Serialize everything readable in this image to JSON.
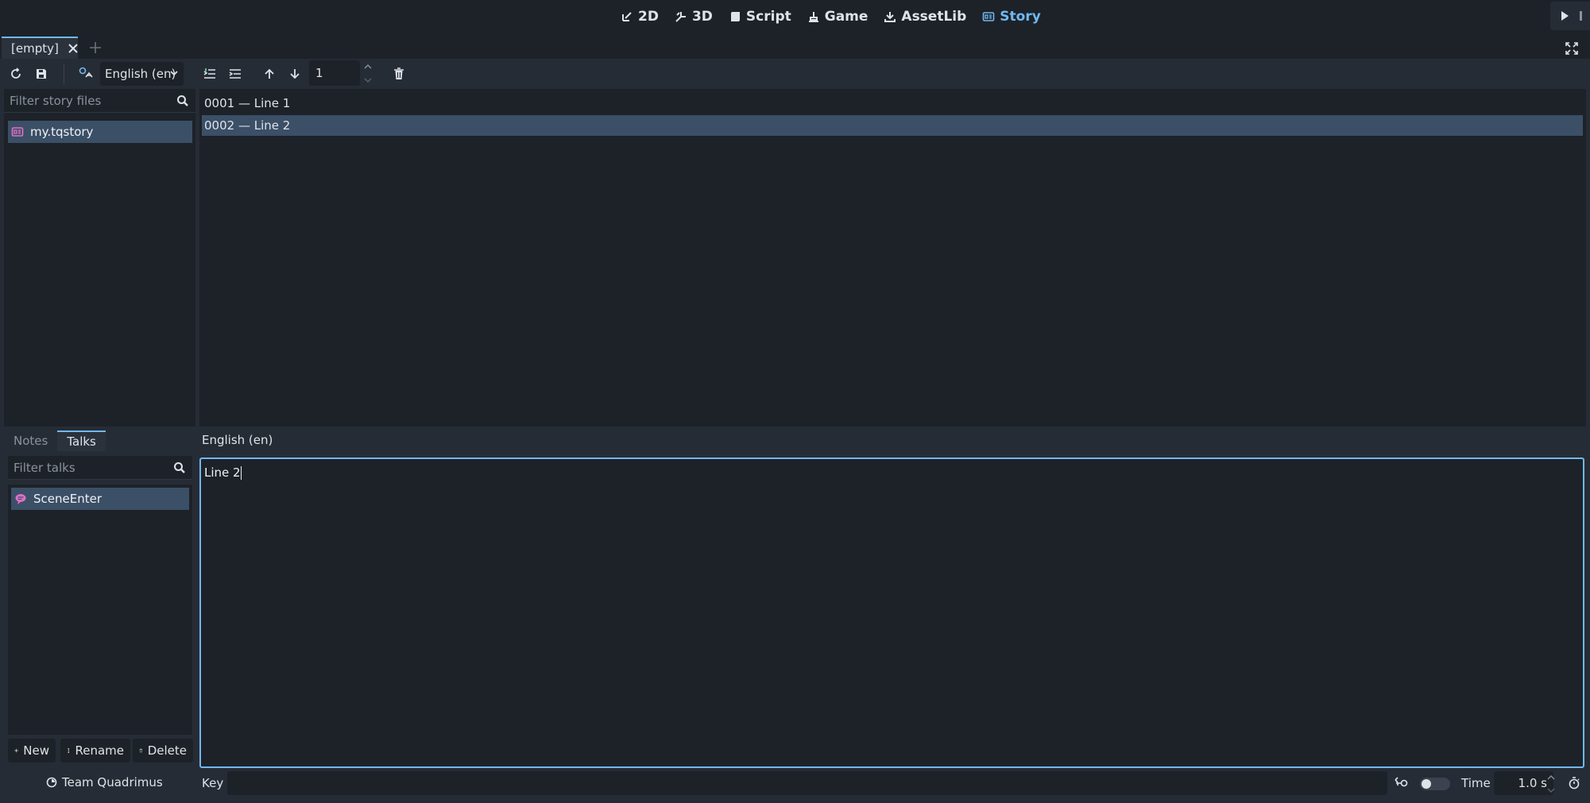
{
  "top_modes": [
    {
      "label": "2D",
      "icon": "2d-icon"
    },
    {
      "label": "3D",
      "icon": "3d-icon"
    },
    {
      "label": "Script",
      "icon": "script-icon"
    },
    {
      "label": "Game",
      "icon": "game-icon"
    },
    {
      "label": "AssetLib",
      "icon": "assetlib-icon"
    },
    {
      "label": "Story",
      "icon": "story-icon",
      "active": true
    }
  ],
  "tab": {
    "label": "[empty]"
  },
  "toolbar": {
    "language": "English (en)",
    "spin_value": "1"
  },
  "file_panel": {
    "filter_placeholder": "Filter story files",
    "files": [
      "my.tqstory"
    ]
  },
  "lines": [
    {
      "label": "0001 — Line 1",
      "selected": false
    },
    {
      "label": "0002 — Line 2",
      "selected": true
    }
  ],
  "subtabs": {
    "notes": "Notes",
    "talks": "Talks"
  },
  "talks_panel": {
    "filter_placeholder": "Filter talks",
    "talks": [
      "SceneEnter"
    ],
    "new_label": "New",
    "rename_label": "Rename",
    "delete_label": "Delete"
  },
  "editor": {
    "language_label": "English (en)",
    "text": "Line 2"
  },
  "bottom": {
    "team": "Team Quadrimus",
    "key_label": "Key",
    "key_value": "",
    "time_label": "Time",
    "time_value": "1.0 s"
  },
  "colors": {
    "accent": "#70b8f0",
    "selection": "#3b4f66",
    "story_icon": "#e070c8"
  }
}
